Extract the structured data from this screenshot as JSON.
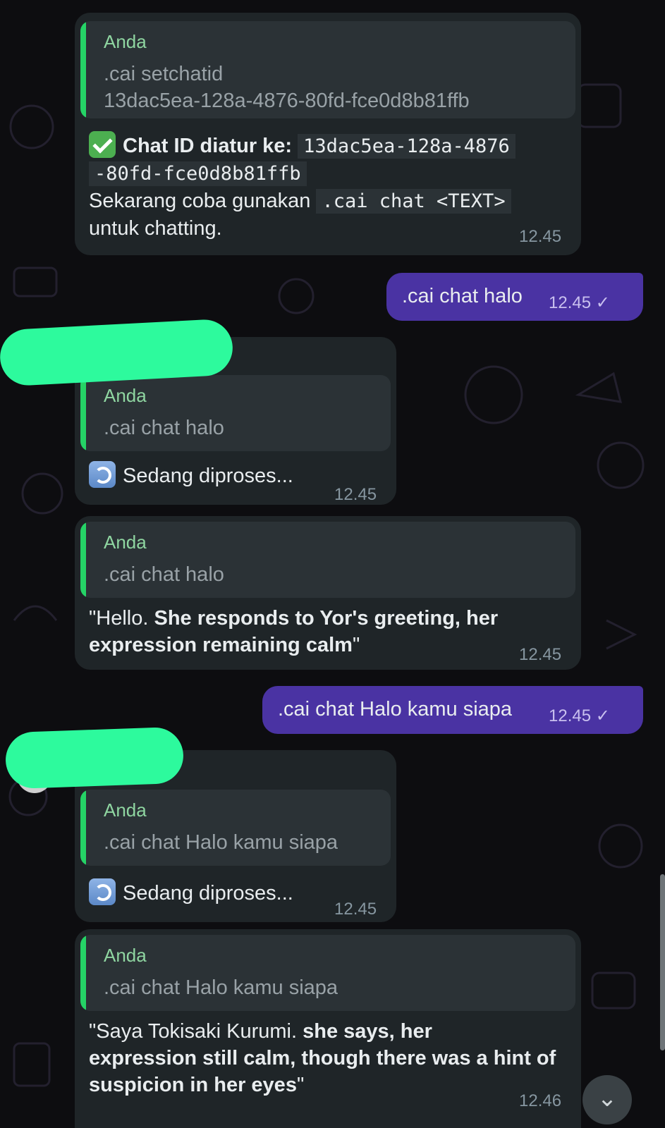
{
  "messages": {
    "m1": {
      "quote_name": "Anda",
      "quote_text": ".cai setchatid\n13dac5ea-128a-4876-80fd-fce0d8b81ffb",
      "bold": "Chat ID diatur ke:",
      "code1": "13dac5ea-128a-4876",
      "code2": "-80fd-fce0d8b81ffb",
      "line3_prefix": "Sekarang coba gunakan",
      "code3": ".cai chat <TEXT>",
      "line4": "untuk chatting.",
      "time": "12.45"
    },
    "m2": {
      "text": ".cai chat halo",
      "time": "12.45 ✓"
    },
    "m3": {
      "quote_name": "Anda",
      "quote_text": ".cai chat halo",
      "text": "Sedang diproses...",
      "time": "12.45"
    },
    "m4": {
      "quote_name": "Anda",
      "quote_text": ".cai chat halo",
      "plain": "\"Hello. ",
      "bold1": "She responds to Yor's greeting, her",
      "bold2": "expression remaining calm",
      "end": "\"",
      "time": "12.45"
    },
    "m5": {
      "text": ".cai chat Halo kamu siapa",
      "time": "12.45 ✓"
    },
    "m6": {
      "quote_name": "Anda",
      "quote_text": ".cai chat Halo kamu siapa",
      "text": "Sedang diproses...",
      "time": "12.45"
    },
    "m7": {
      "quote_name": "Anda",
      "quote_text": ".cai chat Halo kamu siapa",
      "plain": "\"Saya Tokisaki Kurumi. ",
      "bold1": "she says, her",
      "bold2": "expression still calm, though there was a hint of",
      "bold3": "suspicion in her eyes",
      "end": "\"",
      "time": "12.46"
    }
  },
  "scroll_down_icon": "double-chevron-down-icon",
  "colors": {
    "outgoing": "#4a33a3",
    "incoming": "#1f2528",
    "quote_bar": "#25d366",
    "redaction": "#2dfa9d"
  }
}
